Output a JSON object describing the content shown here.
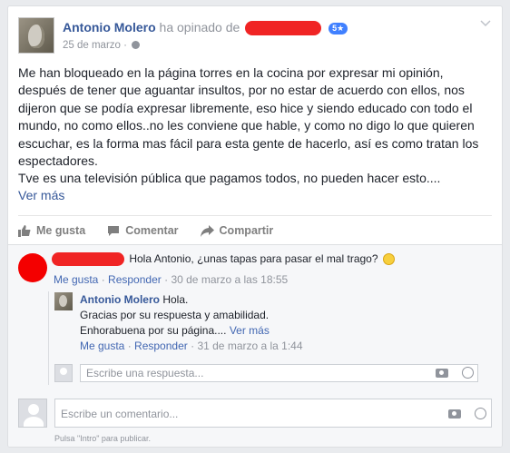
{
  "post": {
    "author": "Antonio Molero",
    "verb": "ha opinado de",
    "rating_badge": "5★",
    "date": "25 de marzo",
    "separator": "·",
    "paragraphs": [
      "Me han bloqueado en la página torres en la cocina por expresar mi opinión, después de tener que aguantar insultos, por no estar de acuerdo con ellos, nos dijeron que se podía expresar libremente, eso hice y siendo educado con todo el mundo, no como ellos..no les conviene que hable, y como no digo lo que quieren escuchar, es la forma mas fácil para esta gente de hacerlo, así es como tratan los espectadores.",
      "Tve es una televisión pública que pagamos todos, no pueden hacer esto...."
    ],
    "see_more": "Ver más"
  },
  "actions": {
    "like": "Me gusta",
    "comment": "Comentar",
    "share": "Compartir"
  },
  "comments": [
    {
      "text": "Hola Antonio, ¿unas tapas para pasar el mal trago?",
      "like": "Me gusta",
      "reply": "Responder",
      "dot": "·",
      "time": "30 de marzo a las 18:55"
    }
  ],
  "reply": {
    "author": "Antonio Molero",
    "line1": "Hola.",
    "line2": "Gracias por su respuesta y amabilidad.",
    "line3": "Enhorabuena por su página....",
    "see_more": "Ver más",
    "like": "Me gusta",
    "reply": "Responder",
    "dot": "·",
    "time": "31 de marzo a la 1:44"
  },
  "reply_input": {
    "placeholder": "Escribe una respuesta..."
  },
  "comment_input": {
    "placeholder": "Escribe un comentario..."
  },
  "hint": "Pulsa \"Intro\" para publicar.",
  "colors": {
    "link": "#365899",
    "redaction": "#f02424",
    "badge": "#4080ff"
  }
}
